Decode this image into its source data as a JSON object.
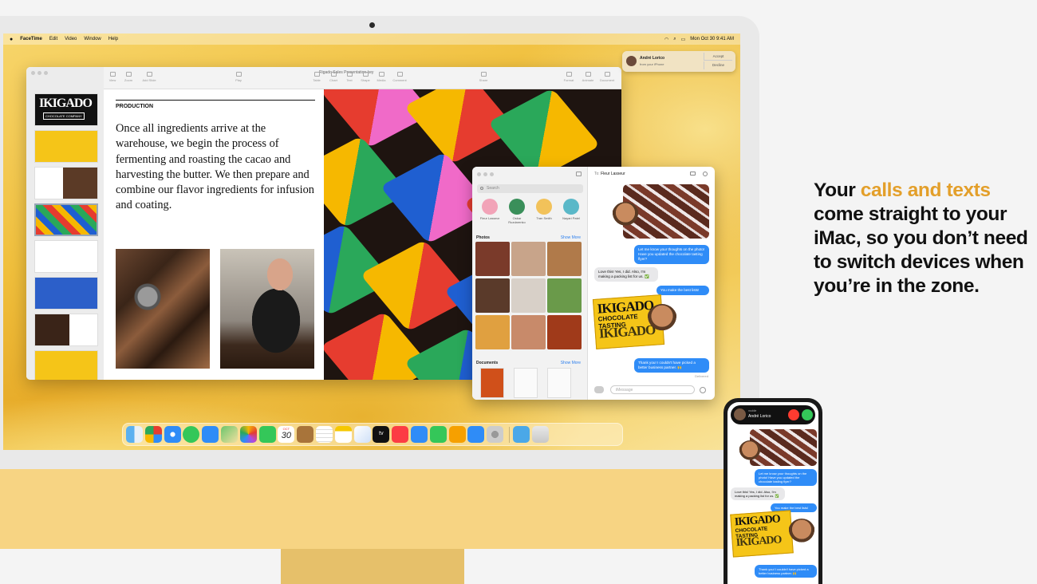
{
  "menubar": {
    "apple": "",
    "app": "FaceTime",
    "items": [
      "Edit",
      "Video",
      "Window",
      "Help"
    ],
    "clock": "Mon Oct 30  9:41 AM"
  },
  "keynote": {
    "window_title": "Rigado Sales Presentation.key",
    "toolbar": [
      "View",
      "Zoom",
      "Add Slide",
      "Play",
      "Table",
      "Chart",
      "Text",
      "Shape",
      "Media",
      "Comment",
      "Share",
      "Format",
      "Animate",
      "Document"
    ],
    "zoom": "90%",
    "thumb_logo": "IKIGADO",
    "thumb_sub": "CHOCOLATE COMPANY",
    "slide": {
      "heading": "PRODUCTION",
      "body": "Once all ingredients arrive at the warehouse, we begin the process of fermenting and roasting the cacao and harvesting the butter. We then prepare and combine our flavor ingredients for infusion and coating."
    }
  },
  "notification": {
    "name": "André Lorico",
    "subtitle": "from your iPhone",
    "accept": "Accept",
    "decline": "Decline"
  },
  "messages": {
    "search_placeholder": "Search",
    "contacts": [
      "Fleur Lasseur",
      "Oskar Ruzdarenko",
      "Tran Smith",
      "Nayari Patel"
    ],
    "photos_label": "Photos",
    "documents_label": "Documents",
    "show_more": "Show More",
    "to_label": "To:",
    "to_name": "Fleur Lasseur",
    "bubbles": {
      "b1": "Let me know your thoughts on the photo! Have you updated the chocolate tasting flyer?",
      "b2": "Love this! Yes, I did. Also, I'm making a packing list for us. ✅",
      "b3": "You make the best lists!",
      "b4": "Thank you! I couldn't have picked a better business partner. 🙌"
    },
    "delivered": "Delivered",
    "compose_placeholder": "iMessage",
    "sticker_top": "IKIGADO",
    "sticker_mid": "CHOCOLATE TASTING",
    "sticker_bot": "IKIGADO"
  },
  "dock": {
    "calendar_month": "OCT",
    "calendar_day": "30",
    "tv_label": "tv"
  },
  "headline": {
    "pre": "Your ",
    "highlight": "calls and texts",
    "post": " come straight to your iMac, so you don’t need to switch devices when you’re in the zone."
  },
  "phone": {
    "call_small": "mobile",
    "call_name": "André Lorico",
    "bubbles": {
      "b1": "Let me know your thoughts on the photo! Have you updated the chocolate tasting flyer?",
      "b2": "Love this! Yes, I did. Also, I'm making a packing list for us. ✅",
      "b3": "You make the best lists!",
      "b4": "Thank you! I couldn't have picked a better business partner. 🙌"
    },
    "sticker_top": "IKIGADO",
    "sticker_mid": "CHOCOLATE TASTING",
    "sticker_bot": "IKIGADO"
  },
  "colors": {
    "accent": "#e39f2a",
    "imessage_blue": "#2f8cf7",
    "imac_yellow": "#f7d483"
  }
}
